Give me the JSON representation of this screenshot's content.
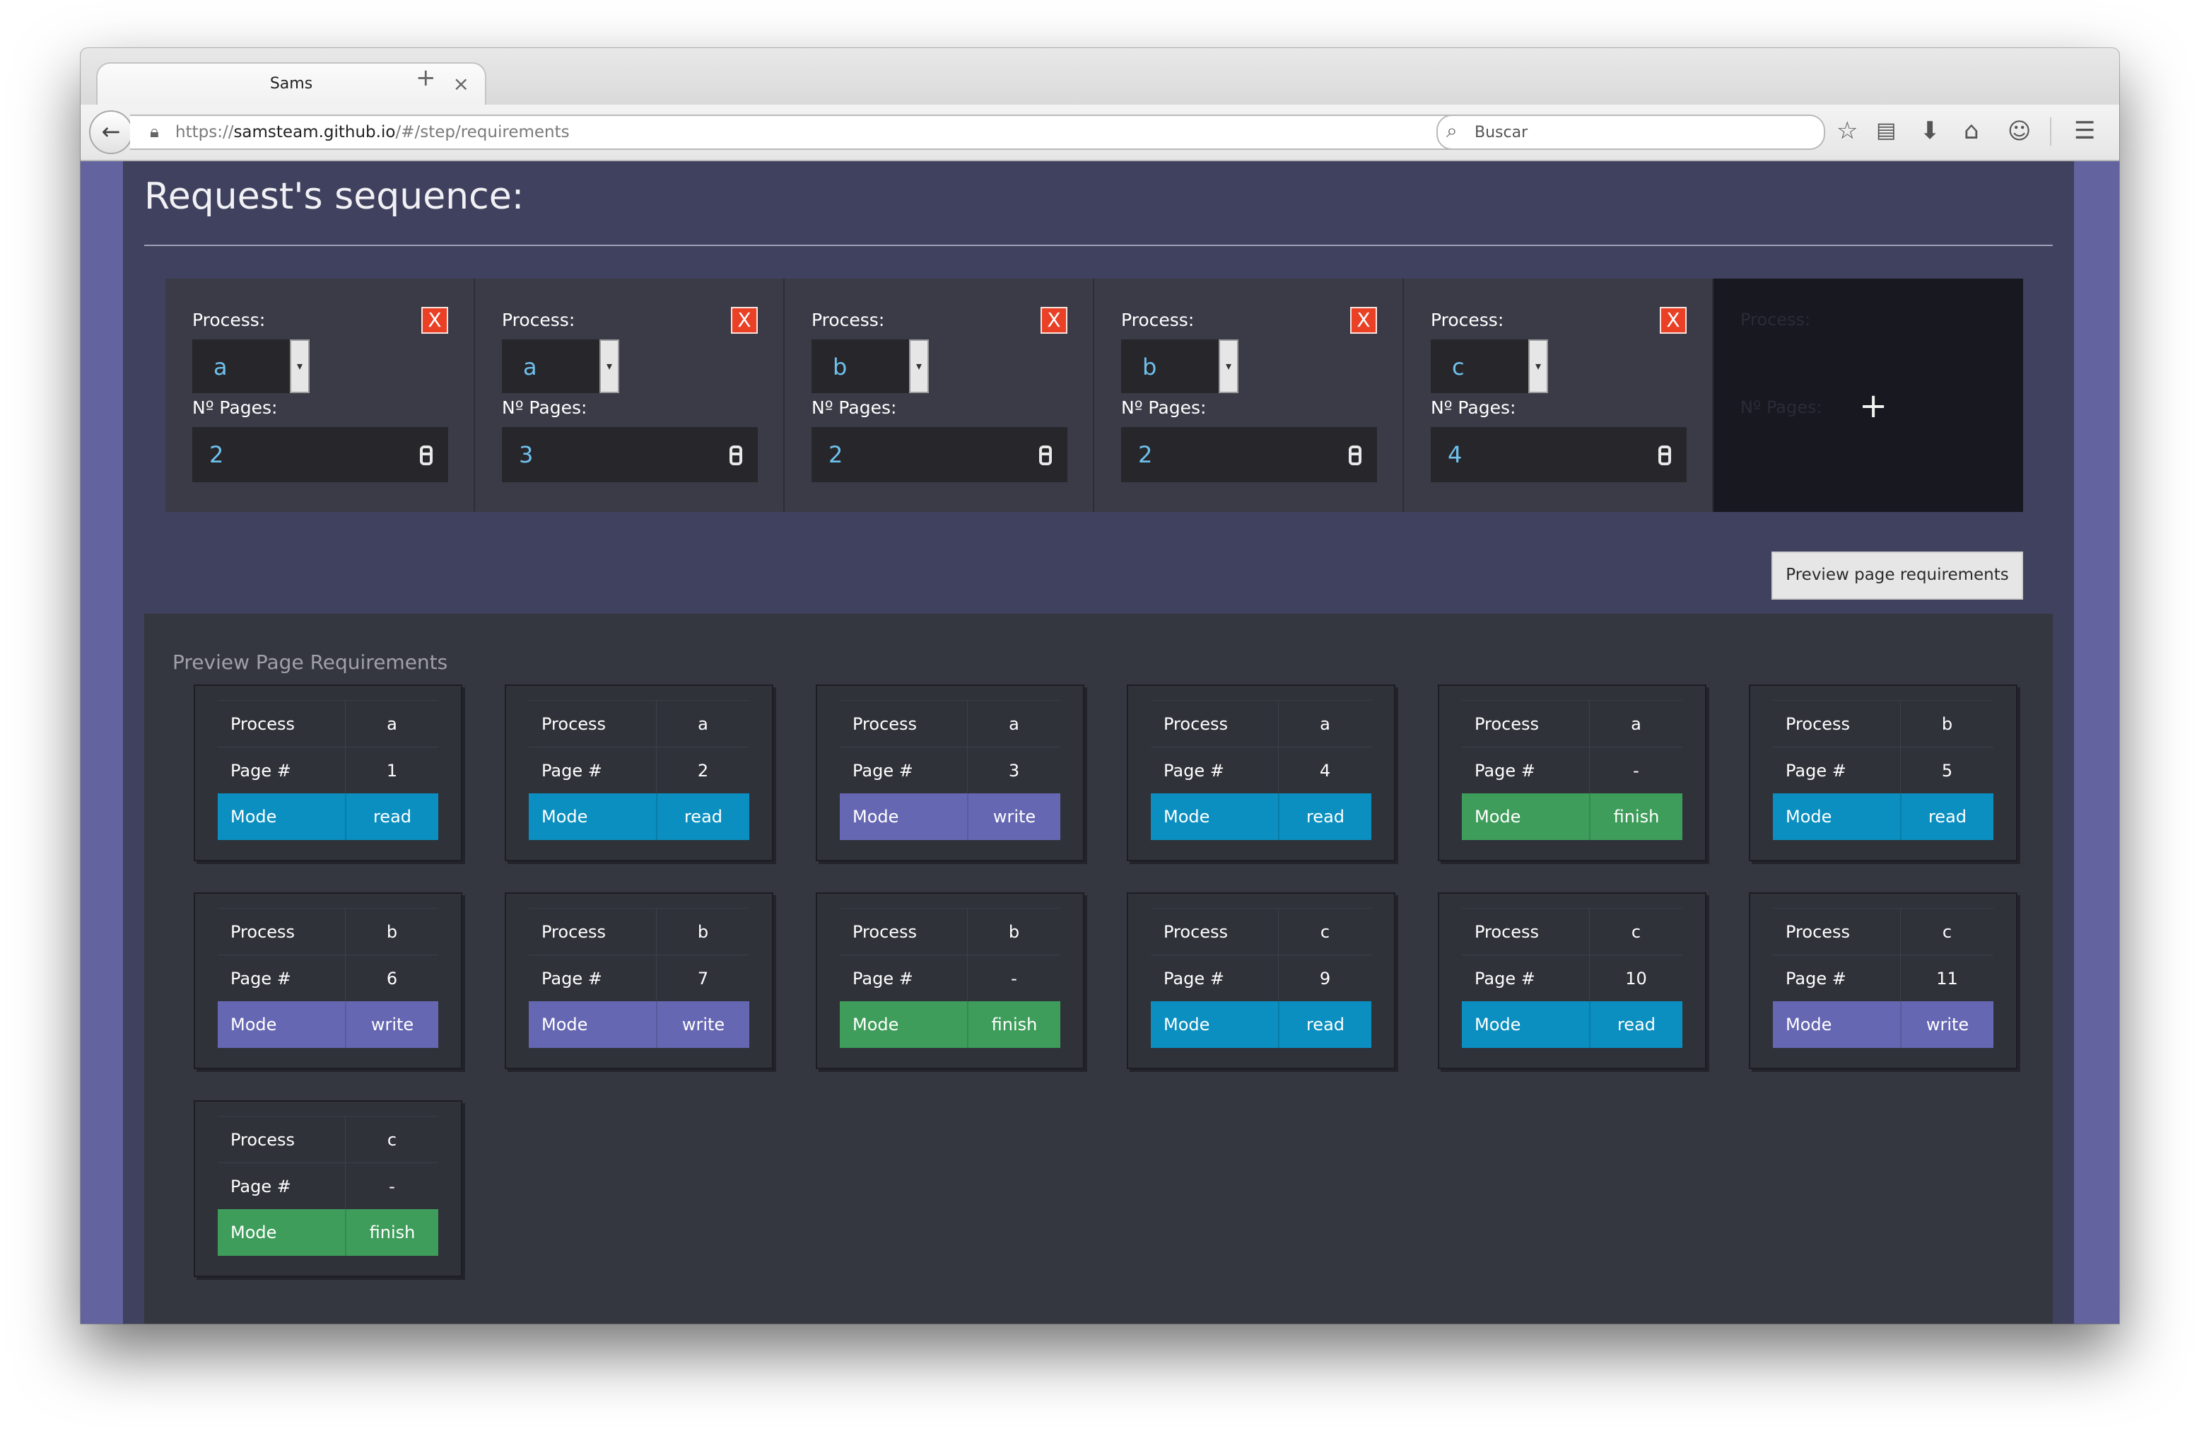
{
  "browser": {
    "tab_title": "Sams",
    "tab_close": "×",
    "new_tab": "+",
    "url_prefix": "https://",
    "url_host": "samsteam.github.io",
    "url_path": "/#/step/requirements",
    "search_placeholder": "Buscar"
  },
  "page": {
    "title": "Request's sequence:",
    "process_label": "Process:",
    "pages_label": "Nº Pages:",
    "delete_label": "X",
    "add_label": "+",
    "processes": [
      {
        "process": "a",
        "pages": "2"
      },
      {
        "process": "a",
        "pages": "3"
      },
      {
        "process": "b",
        "pages": "2"
      },
      {
        "process": "b",
        "pages": "2"
      },
      {
        "process": "c",
        "pages": "4"
      }
    ],
    "preview_button": "Preview page requirements"
  },
  "preview": {
    "title": "Preview Page Requirements",
    "labels": {
      "process": "Process",
      "page": "Page #",
      "mode": "Mode"
    },
    "mode_colors": {
      "read": "#0a8fc0",
      "write": "#6667b3",
      "finish": "#3e9d5a"
    },
    "requirements": [
      {
        "process": "a",
        "page": "1",
        "mode": "read"
      },
      {
        "process": "a",
        "page": "2",
        "mode": "read"
      },
      {
        "process": "a",
        "page": "3",
        "mode": "write"
      },
      {
        "process": "a",
        "page": "4",
        "mode": "read"
      },
      {
        "process": "a",
        "page": "-",
        "mode": "finish"
      },
      {
        "process": "b",
        "page": "5",
        "mode": "read"
      },
      {
        "process": "b",
        "page": "6",
        "mode": "write"
      },
      {
        "process": "b",
        "page": "7",
        "mode": "write"
      },
      {
        "process": "b",
        "page": "-",
        "mode": "finish"
      },
      {
        "process": "c",
        "page": "9",
        "mode": "read"
      },
      {
        "process": "c",
        "page": "10",
        "mode": "read"
      },
      {
        "process": "c",
        "page": "11",
        "mode": "write"
      },
      {
        "process": "c",
        "page": "-",
        "mode": "finish"
      }
    ]
  }
}
